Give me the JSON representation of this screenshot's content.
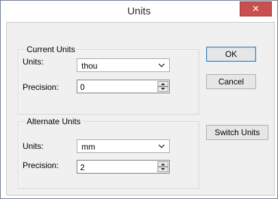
{
  "window": {
    "title": "Units",
    "close_glyph": "✕"
  },
  "current_units": {
    "group_label": "Current Units",
    "units_label": "Units:",
    "units_value": "thou",
    "precision_label": "Precision:",
    "precision_value": "0"
  },
  "alternate_units": {
    "group_label": "Alternate Units",
    "units_label": "Units:",
    "units_value": "mm",
    "precision_label": "Precision:",
    "precision_value": "2"
  },
  "buttons": {
    "ok": "OK",
    "cancel": "Cancel",
    "switch_units": "Switch Units"
  },
  "colors": {
    "close_button": "#c74f50",
    "dialog_face": "#f0f0f0",
    "default_button_border": "#3c7fb1"
  }
}
